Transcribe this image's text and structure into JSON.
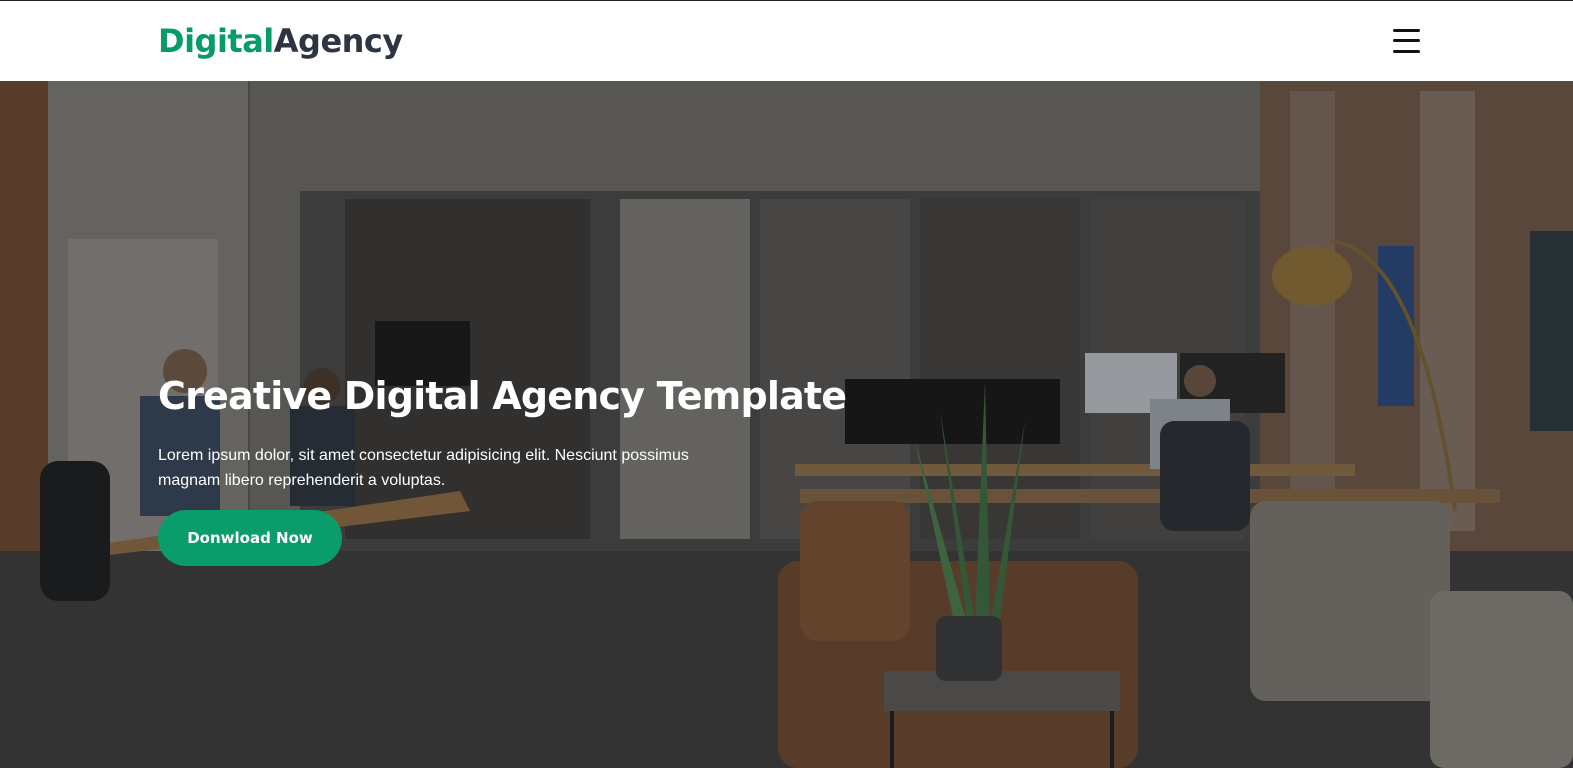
{
  "navbar": {
    "logo_primary": "Digital",
    "logo_secondary": "Agency",
    "menu_icon": "hamburger-menu-icon"
  },
  "hero": {
    "title": "Creative Digital Agency Template",
    "description": "Lorem ipsum dolor, sit amet consectetur adipisicing elit. Nesciunt possimus magnam libero reprehenderit a voluptas.",
    "cta_label": "Donwload Now",
    "background_image": "office-interior-photo"
  },
  "colors": {
    "brand_green": "#079a6a",
    "logo_dark": "#2d3544",
    "button_green": "#0a9c6b"
  }
}
